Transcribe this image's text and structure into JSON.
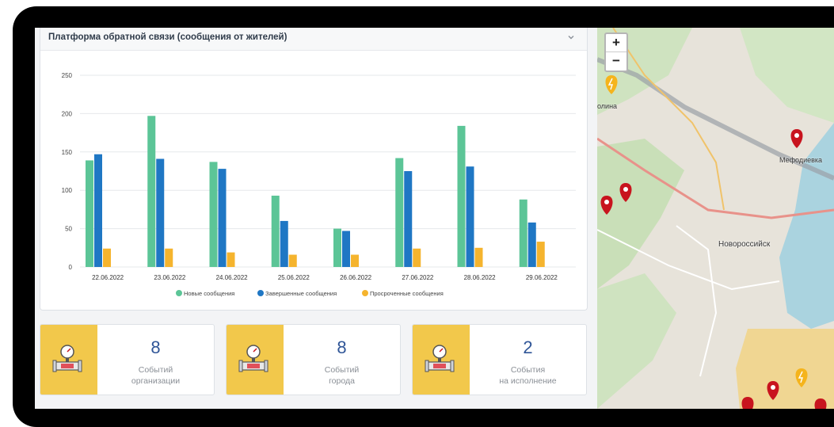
{
  "panel": {
    "title": "Платформа обратной связи (сообщения от жителей)"
  },
  "chart_data": {
    "type": "bar",
    "categories": [
      "22.06.2022",
      "23.06.2022",
      "24.06.2022",
      "25.06.2022",
      "26.06.2022",
      "27.06.2022",
      "28.06.2022",
      "29.06.2022"
    ],
    "series": [
      {
        "name": "Новые сообщения",
        "color": "#5cc597",
        "values": [
          139,
          197,
          137,
          93,
          50,
          142,
          184,
          88
        ]
      },
      {
        "name": "Завершенные сообщения",
        "color": "#1f77c4",
        "values": [
          147,
          141,
          128,
          60,
          47,
          125,
          131,
          58
        ]
      },
      {
        "name": "Просроченные сообщения",
        "color": "#f5b42e",
        "values": [
          24,
          24,
          19,
          16,
          16,
          24,
          25,
          33
        ]
      }
    ],
    "ylim": [
      0,
      250
    ],
    "yticks": [
      "250",
      "200",
      "150",
      "100",
      "50",
      "0"
    ],
    "grid": true,
    "legend": "bottom"
  },
  "cards": [
    {
      "value": "8",
      "label": "Событий\nорганизации",
      "icon": "pipe-gauge-icon"
    },
    {
      "value": "8",
      "label": "Событий\nгорода",
      "icon": "pipe-gauge-icon"
    },
    {
      "value": "2",
      "label": "События\nна исполнение",
      "icon": "pipe-gauge-icon"
    }
  ],
  "map": {
    "zoom_in": "+",
    "zoom_out": "−",
    "city": "Новороссийск",
    "town": "Мефодиевка",
    "west_label": "олина"
  },
  "colors": {
    "accent": "#f2c84b",
    "value": "#2f5597",
    "pin_red": "#c8141e",
    "pin_yellow": "#f5b41c"
  }
}
